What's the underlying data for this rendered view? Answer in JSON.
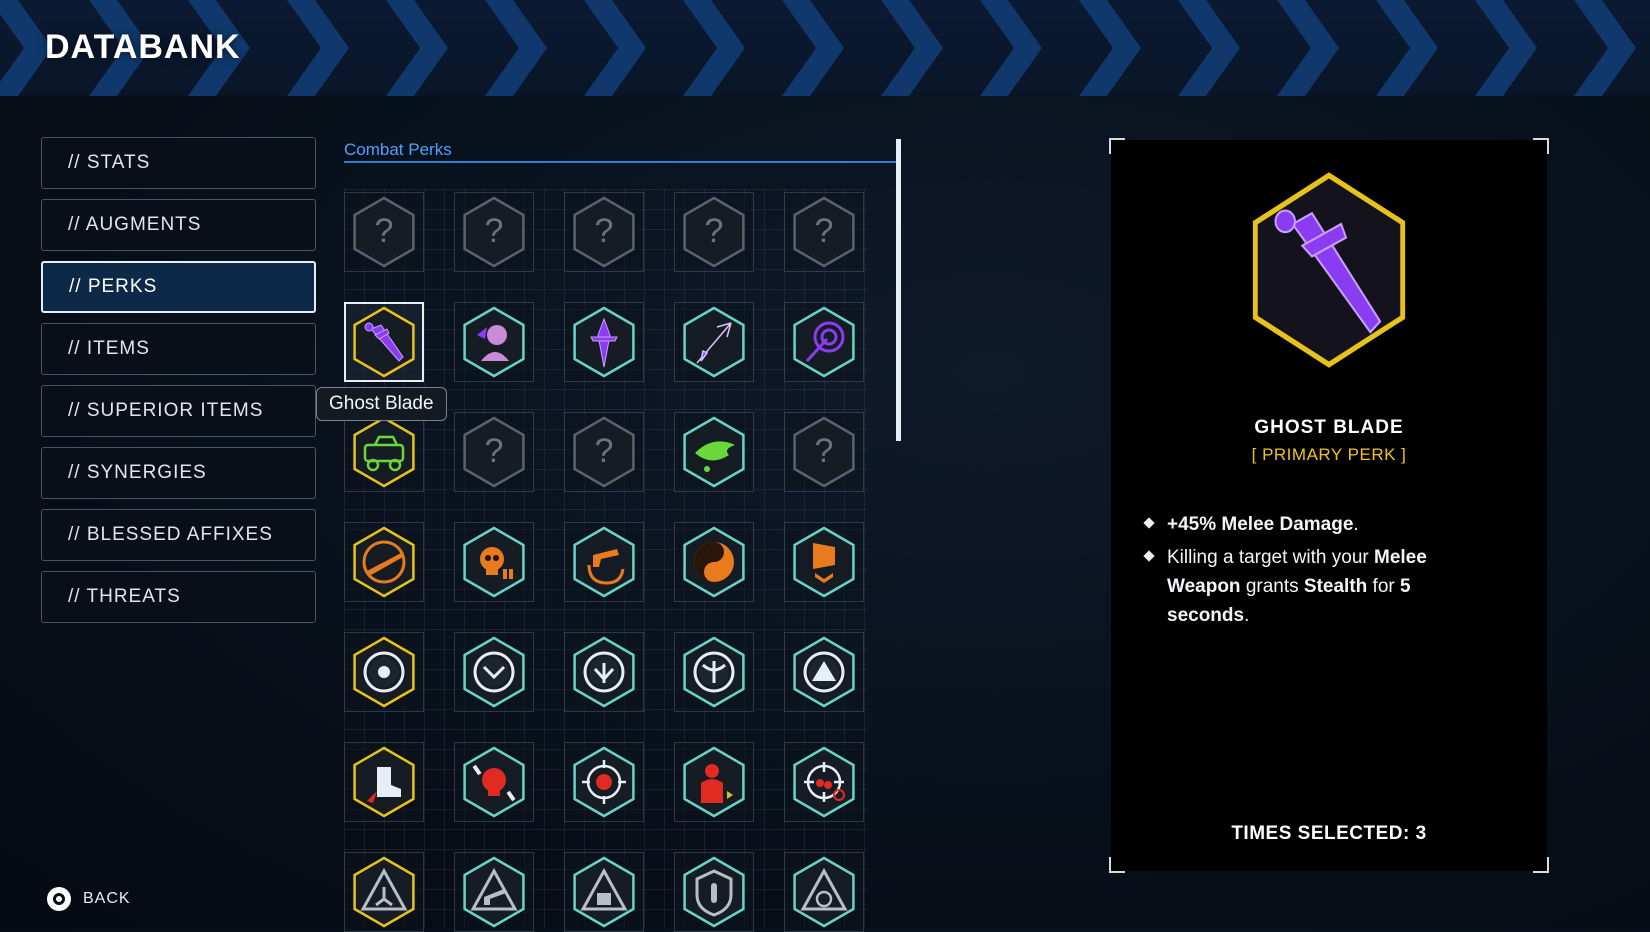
{
  "header": {
    "title": "DATABANK"
  },
  "nav": {
    "items": [
      {
        "label": "// STATS"
      },
      {
        "label": "// AUGMENTS"
      },
      {
        "label": "// PERKS",
        "active": true
      },
      {
        "label": "// ITEMS"
      },
      {
        "label": "// SUPERIOR ITEMS"
      },
      {
        "label": "// SYNERGIES"
      },
      {
        "label": "// BLESSED AFFIXES"
      },
      {
        "label": "// THREATS"
      }
    ]
  },
  "perks": {
    "section_title": "Combat Perks",
    "tooltip": "Ghost Blade",
    "rows": [
      [
        "locked-icon",
        "locked-icon",
        "locked-icon",
        "locked-icon",
        "locked-icon"
      ],
      [
        "ghost-blade-icon",
        "ghost-warrior-icon",
        "phantom-dagger-icon",
        "shadow-arrow-icon",
        "spiral-strike-icon"
      ],
      [
        "rover-vehicle-icon",
        "locked-icon",
        "locked-icon",
        "green-flame-icon",
        "locked-icon"
      ],
      [
        "shotgun-icon",
        "skull-reload-icon",
        "revolver-spin-icon",
        "yin-yang-icon",
        "armor-chevron-icon"
      ],
      [
        "shutter-orb-icon",
        "shield-chevron-orb-icon",
        "wing-orb-icon",
        "phoenix-orb-icon",
        "pyramid-orb-icon"
      ],
      [
        "stomp-boot-icon",
        "bullet-skull-icon",
        "explosive-burst-icon",
        "target-dummy-icon",
        "crosshair-bloom-icon"
      ],
      [
        "triad-triangle-icon",
        "gun-triangle-icon",
        "dice-triangle-icon",
        "bullet-shield-icon",
        "spiral-triangle-icon"
      ]
    ],
    "frames": [
      [
        "#5a6270",
        "#5a6270",
        "#5a6270",
        "#5a6270",
        "#5a6270"
      ],
      [
        "#e8c21c",
        "#69d3c4",
        "#69d3c4",
        "#69d3c4",
        "#69d3c4"
      ],
      [
        "#e8c21c",
        "#5a6270",
        "#5a6270",
        "#69d3c4",
        "#5a6270"
      ],
      [
        "#e8c21c",
        "#69d3c4",
        "#69d3c4",
        "#69d3c4",
        "#69d3c4"
      ],
      [
        "#e8c21c",
        "#69d3c4",
        "#69d3c4",
        "#69d3c4",
        "#69d3c4"
      ],
      [
        "#e8c21c",
        "#69d3c4",
        "#69d3c4",
        "#69d3c4",
        "#69d3c4"
      ],
      [
        "#e8c21c",
        "#69d3c4",
        "#69d3c4",
        "#69d3c4",
        "#69d3c4"
      ]
    ],
    "colors": {
      "purple": "#8a3cf0",
      "orange": "#e87b1e",
      "green": "#6ad83a",
      "white": "#e8eef5",
      "red": "#e02a22",
      "grey": "#b8bec6"
    }
  },
  "detail": {
    "icon": "ghost-blade-icon",
    "name": "GHOST BLADE",
    "type": "[ PRIMARY PERK ]",
    "bullets": [
      {
        "text_html": "<b>+45% Melee Damage</b>."
      },
      {
        "text_html": "Killing a target with your <b>Melee Weapon</b> grants <b>Stealth</b> for <b>5 seconds</b>."
      }
    ],
    "times_selected": "TIMES SELECTED: 3"
  },
  "footer": {
    "back_label": "BACK",
    "back_icon": "circle-button-icon"
  },
  "accent": {
    "frame_gold": "#e8c21c",
    "frame_teal": "#69d3c4",
    "link_blue": "#4aa3ff"
  }
}
